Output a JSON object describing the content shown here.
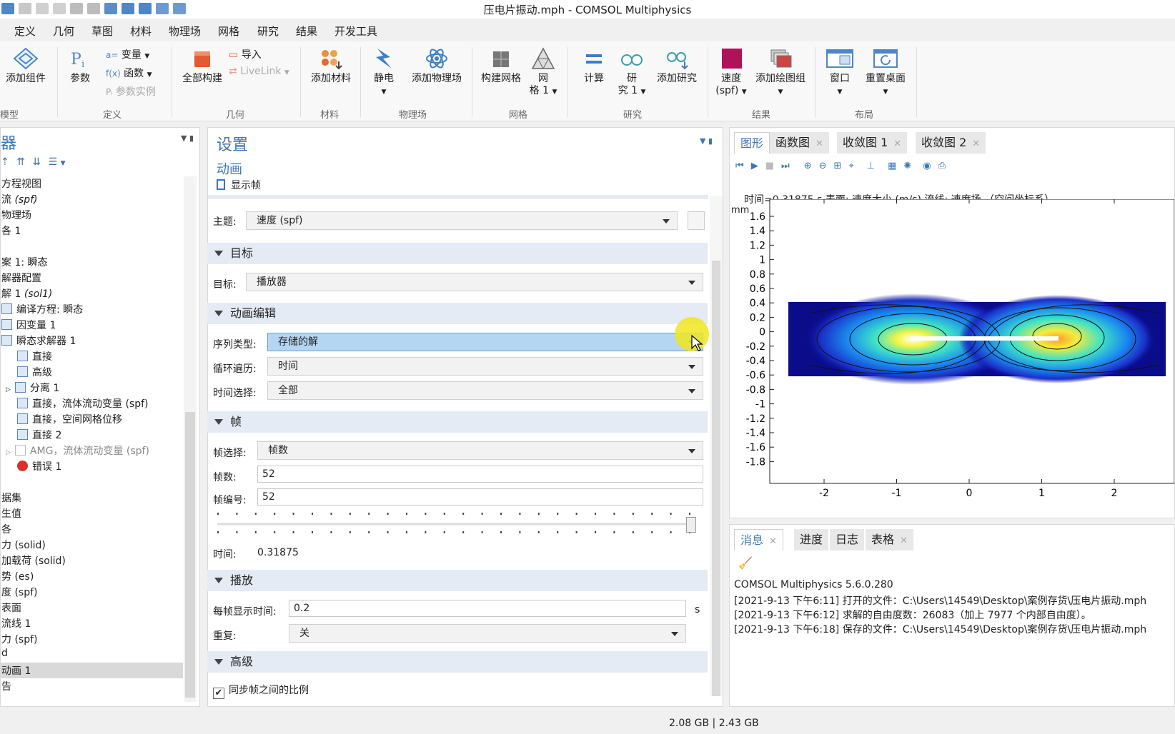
{
  "window": {
    "title": "压电片振动.mph - COMSOL Multiphysics"
  },
  "menu": [
    "定义",
    "几何",
    "草图",
    "材料",
    "物理场",
    "网格",
    "研究",
    "结果",
    "开发工具"
  ],
  "ribbon": {
    "add_component": "添加组件",
    "params": "参数",
    "variables": "变量",
    "functions": "函数",
    "param_case": "参数实例",
    "build_all": "全部构建",
    "import": "导入",
    "livelink": "LiveLink",
    "add_material": "添加材料",
    "electrostatics": "静电",
    "add_physics": "添加物理场",
    "build_mesh": "构建网格",
    "mesh1_a": "网",
    "mesh1_b": "格 1",
    "compute": "计算",
    "study_a": "研",
    "study_b": "究 1",
    "add_study": "添加研究",
    "velocity_a": "速度",
    "velocity_b": "(spf)",
    "add_plot_group": "添加绘图组",
    "windows": "窗口",
    "reset_desktop": "重置桌面",
    "groups": {
      "model": "模型",
      "definitions": "定义",
      "geometry": "几何",
      "materials": "材料",
      "physics": "物理场",
      "mesh": "网格",
      "study": "研究",
      "results": "结果",
      "layout": "布局"
    }
  },
  "left_panel": {
    "title": "器",
    "items": [
      {
        "text": "方程视图",
        "italic": ""
      },
      {
        "text": "流 ",
        "italic": "(spf)"
      },
      {
        "text": "物理场",
        "italic": ""
      },
      {
        "text": "各 1",
        "italic": ""
      },
      {
        "text": "",
        "italic": ""
      },
      {
        "text": "案 1: 瞬态",
        "italic": ""
      },
      {
        "text": "解器配置",
        "italic": ""
      },
      {
        "text": "解 1 ",
        "italic": "(sol1)"
      },
      {
        "text": "编译方程: 瞬态",
        "italic": ""
      },
      {
        "text": "因变量 1",
        "italic": ""
      },
      {
        "text": "瞬态求解器 1",
        "italic": ""
      },
      {
        "text": "直接",
        "italic": ""
      },
      {
        "text": "高级",
        "italic": ""
      },
      {
        "text": "分离 1",
        "italic": ""
      },
      {
        "text": "直接，流体流动变量 (spf)",
        "italic": ""
      },
      {
        "text": "直接，空间网格位移",
        "italic": ""
      },
      {
        "text": "直接 2",
        "italic": ""
      },
      {
        "text": "AMG，流体流动变量 (spf)",
        "italic": ""
      },
      {
        "text": "错误 1",
        "italic": ""
      },
      {
        "text": "",
        "italic": ""
      },
      {
        "text": "据集",
        "italic": ""
      },
      {
        "text": "生值",
        "italic": ""
      },
      {
        "text": "各",
        "italic": ""
      },
      {
        "text": "力 (solid)",
        "italic": ""
      },
      {
        "text": "加载荷 (solid)",
        "italic": ""
      },
      {
        "text": "势 (es)",
        "italic": ""
      },
      {
        "text": "度 (spf)",
        "italic": ""
      },
      {
        "text": "表面",
        "italic": ""
      },
      {
        "text": "流线 1",
        "italic": ""
      },
      {
        "text": "力 (spf)",
        "italic": ""
      },
      {
        "text": "d",
        "italic": ""
      },
      {
        "text": "动画 1",
        "italic": ""
      },
      {
        "text": "告",
        "italic": ""
      }
    ]
  },
  "settings": {
    "title": "设置",
    "subtitle": "动画",
    "show_frame": "显示帧",
    "subject_label": "主题:",
    "subject_value": "速度 (spf)",
    "sec_target": "目标",
    "target_label": "目标:",
    "target_value": "播放器",
    "sec_anim_edit": "动画编辑",
    "seq_label": "序列类型:",
    "seq_value": "存储的解",
    "loop_label": "循环遍历:",
    "loop_value": "时间",
    "timesel_label": "时间选择:",
    "timesel_value": "全部",
    "sec_frames": "帧",
    "framesel_label": "帧选择:",
    "framesel_value": "帧数",
    "nframes_label": "帧数:",
    "nframes_value": "52",
    "frameno_label": "帧编号:",
    "frameno_value": "52",
    "time_label": "时间:",
    "time_value": "0.31875",
    "slider_fraction": 1.0,
    "sec_play": "播放",
    "frametime_label": "每帧显示时间:",
    "frametime_value": "0.2",
    "frametime_unit": "s",
    "repeat_label": "重复:",
    "repeat_value": "关",
    "sec_advanced": "高级",
    "sync_label": "同步帧之间的比例"
  },
  "graphics": {
    "tabs": [
      "图形",
      "函数图",
      "收敛图 1",
      "收敛图 2"
    ],
    "caption": "时间=0.31875 s      表面: 速度大小 (m/s)   流线: 速度场  （空间坐标系）",
    "unit": "mm",
    "yticks": [
      "1.6",
      "1.4",
      "1.2",
      "1",
      "0.8",
      "0.6",
      "0.4",
      "0.2",
      "0",
      "-0.2",
      "-0.4",
      "-0.6",
      "-0.8",
      "-1",
      "-1.2",
      "-1.4",
      "-1.6",
      "-1.8"
    ],
    "xticks": [
      "-2",
      "-1",
      "0",
      "1",
      "2"
    ]
  },
  "messages": {
    "tabs": [
      "消息",
      "进度",
      "日志",
      "表格"
    ],
    "lines": [
      "COMSOL Multiphysics 5.6.0.280",
      "[2021-9-13 下午6:11] 打开的文件：C:\\Users\\14549\\Desktop\\案例存货\\压电片振动.mph",
      "[2021-9-13 下午6:12] 求解的自由度数：26083（加上 7977 个内部自由度）。",
      "[2021-9-13 下午6:18] 保存的文件：C:\\Users\\14549\\Desktop\\案例存货\\压电片振动.mph"
    ]
  },
  "status": {
    "memory": "2.08 GB | 2.43 GB"
  },
  "colors": {
    "accent": "#3a78b5",
    "highlight": "#b5d6f3",
    "section": "#e4ebf4",
    "cursor": "#f0e61e"
  }
}
